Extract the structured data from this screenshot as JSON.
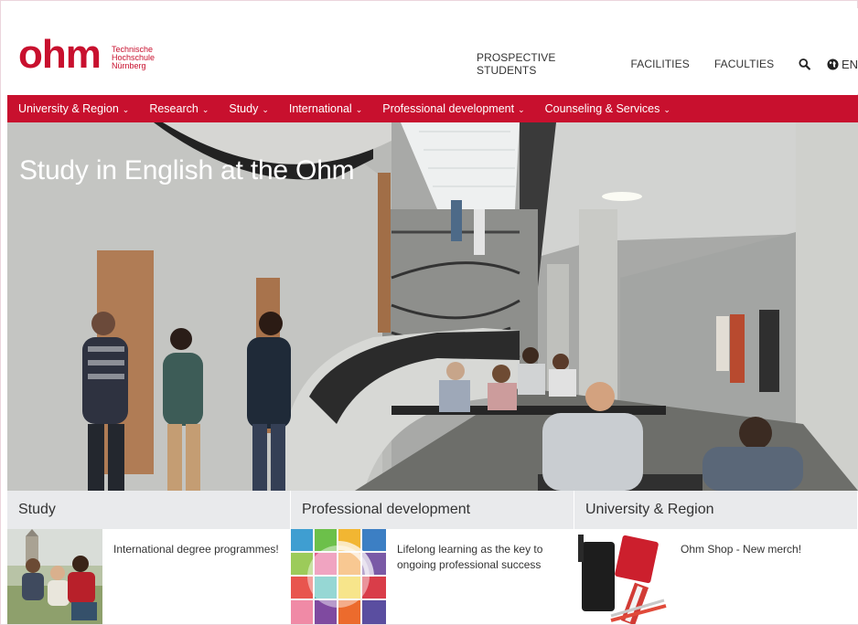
{
  "brand": {
    "logo_text": "ohm",
    "logo_subtitle_1": "Technische",
    "logo_subtitle_2": "Hochschule",
    "logo_subtitle_3": "Nürnberg",
    "color": "#c8102e"
  },
  "topnav": {
    "links": [
      "PROSPECTIVE STUDENTS",
      "FACILITIES",
      "FACULTIES"
    ],
    "search_icon": "search-icon",
    "language": "EN"
  },
  "mainnav": {
    "items": [
      "University & Region",
      "Research",
      "Study",
      "International",
      "Professional development",
      "Counseling & Services"
    ]
  },
  "hero": {
    "title": "Study in English at the Ohm"
  },
  "cards": [
    {
      "heading": "Study",
      "text": "International degree programmes!"
    },
    {
      "heading": "Professional development",
      "text": "Lifelong learning as the key to ongoing professional success"
    },
    {
      "heading": "University & Region",
      "text": "Ohm Shop - New merch!"
    }
  ]
}
